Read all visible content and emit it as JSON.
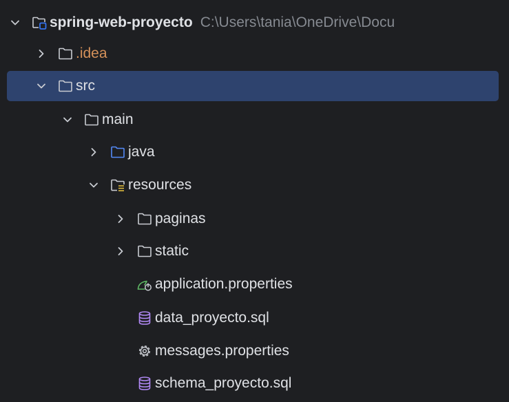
{
  "tree": {
    "project": {
      "name": "spring-web-proyecto",
      "path": "C:\\Users\\tania\\OneDrive\\Docu"
    },
    "nodes": {
      "idea": {
        "label": ".idea"
      },
      "src": {
        "label": "src"
      },
      "main": {
        "label": "main"
      },
      "java": {
        "label": "java"
      },
      "resources": {
        "label": "resources"
      },
      "paginas": {
        "label": "paginas"
      },
      "static": {
        "label": "static"
      },
      "application_properties": {
        "label": "application.properties"
      },
      "data_proyecto_sql": {
        "label": "data_proyecto.sql"
      },
      "messages_properties": {
        "label": "messages.properties"
      },
      "schema_proyecto_sql": {
        "label": "schema_proyecto.sql"
      }
    }
  },
  "colors": {
    "background": "#1e1f22",
    "selection": "#2e436e",
    "text": "#dfe1e5",
    "excluded_text": "#d5915a",
    "path_text": "#868a91",
    "source_folder": "#548af7",
    "module_square": "#3574f0",
    "spring_leaf": "#5fb865",
    "database": "#b189f5",
    "resource_lines": "#e8c33e"
  },
  "icons": {
    "module": "module-folder-icon",
    "folder": "folder-icon",
    "source_root": "source-folder-icon",
    "resources_root": "resources-folder-icon",
    "spring_config": "spring-leaf-icon",
    "database_file": "database-icon",
    "settings_file": "gear-icon",
    "expanded": "chevron-down-icon",
    "collapsed": "chevron-right-icon"
  }
}
